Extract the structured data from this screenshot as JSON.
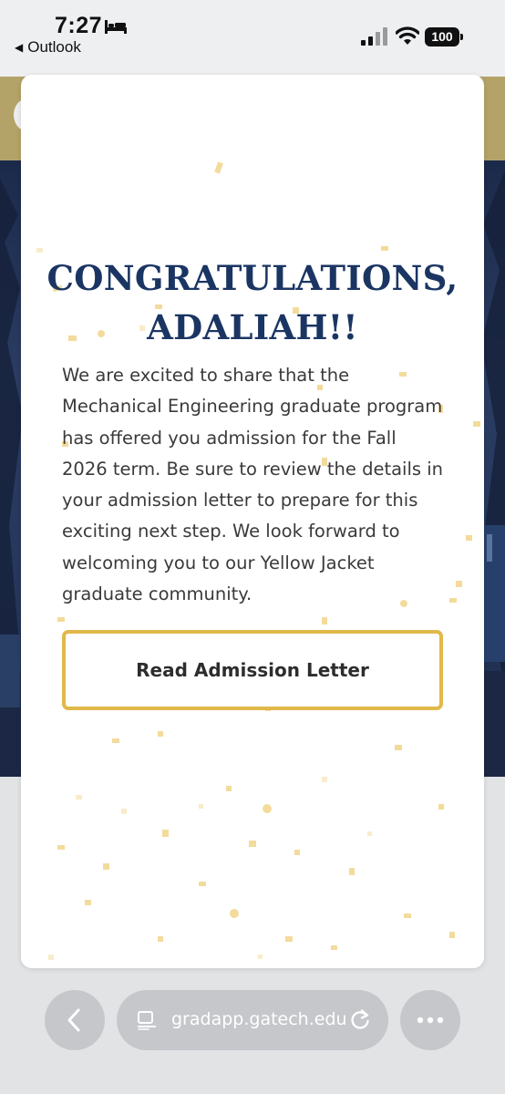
{
  "status_bar": {
    "time": "7:27",
    "back_app": "Outlook",
    "battery": "100",
    "icons": [
      "bed-icon",
      "signal-icon",
      "wifi-icon",
      "battery-icon"
    ]
  },
  "modal": {
    "headline_line1": "CONGRATULATIONS,",
    "headline_line2": "ADALIAH!!",
    "body": "We are excited to share that the Mechanical Engineering graduate program has offered you admission for the Fall 2026 term. Be sure to review the details in your admission letter to prepare for this exciting next step. We look forward to welcoming you to our Yellow Jacket graduate community.",
    "button_label": "Read Admission Letter"
  },
  "browser": {
    "url": "gradapp.gatech.edu",
    "icons": [
      "chevron-left-icon",
      "reader-icon",
      "reload-icon",
      "more-icon"
    ]
  },
  "colors": {
    "headline": "#1b3563",
    "button_border": "#e1b84a",
    "header_gold": "#b3a369",
    "campus_navy": "#1c2a4a"
  }
}
